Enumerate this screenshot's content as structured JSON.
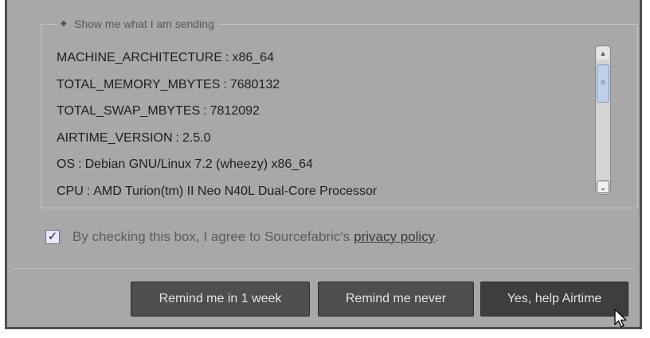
{
  "legend": {
    "icon": "expand-collapse-icon",
    "label": "Show me what I am sending"
  },
  "system_info": [
    {
      "key": "MACHINE_ARCHITECTURE",
      "value": "x86_64"
    },
    {
      "key": "TOTAL_MEMORY_MBYTES",
      "value": "7680132"
    },
    {
      "key": "TOTAL_SWAP_MBYTES",
      "value": "7812092"
    },
    {
      "key": "AIRTIME_VERSION",
      "value": "2.5.0"
    },
    {
      "key": "OS",
      "value": "Debian GNU/Linux 7.2 (wheezy) x86_64"
    },
    {
      "key": "CPU",
      "value": "AMD Turion(tm) II Neo N40L Dual-Core Processor"
    }
  ],
  "separator": ":",
  "consent": {
    "checked": true,
    "text": "By checking this box, I agree to Sourcefabric's",
    "link_label": "privacy policy",
    "suffix": "."
  },
  "buttons": {
    "remind_week": "Remind me in 1 week",
    "remind_never": "Remind me never",
    "yes_help": "Yes, help Airtime"
  },
  "colors": {
    "dialog_bg": "#a8a8a8",
    "button_bg": "#4e4e4e",
    "scroll_thumb": "#bcd0ea"
  }
}
